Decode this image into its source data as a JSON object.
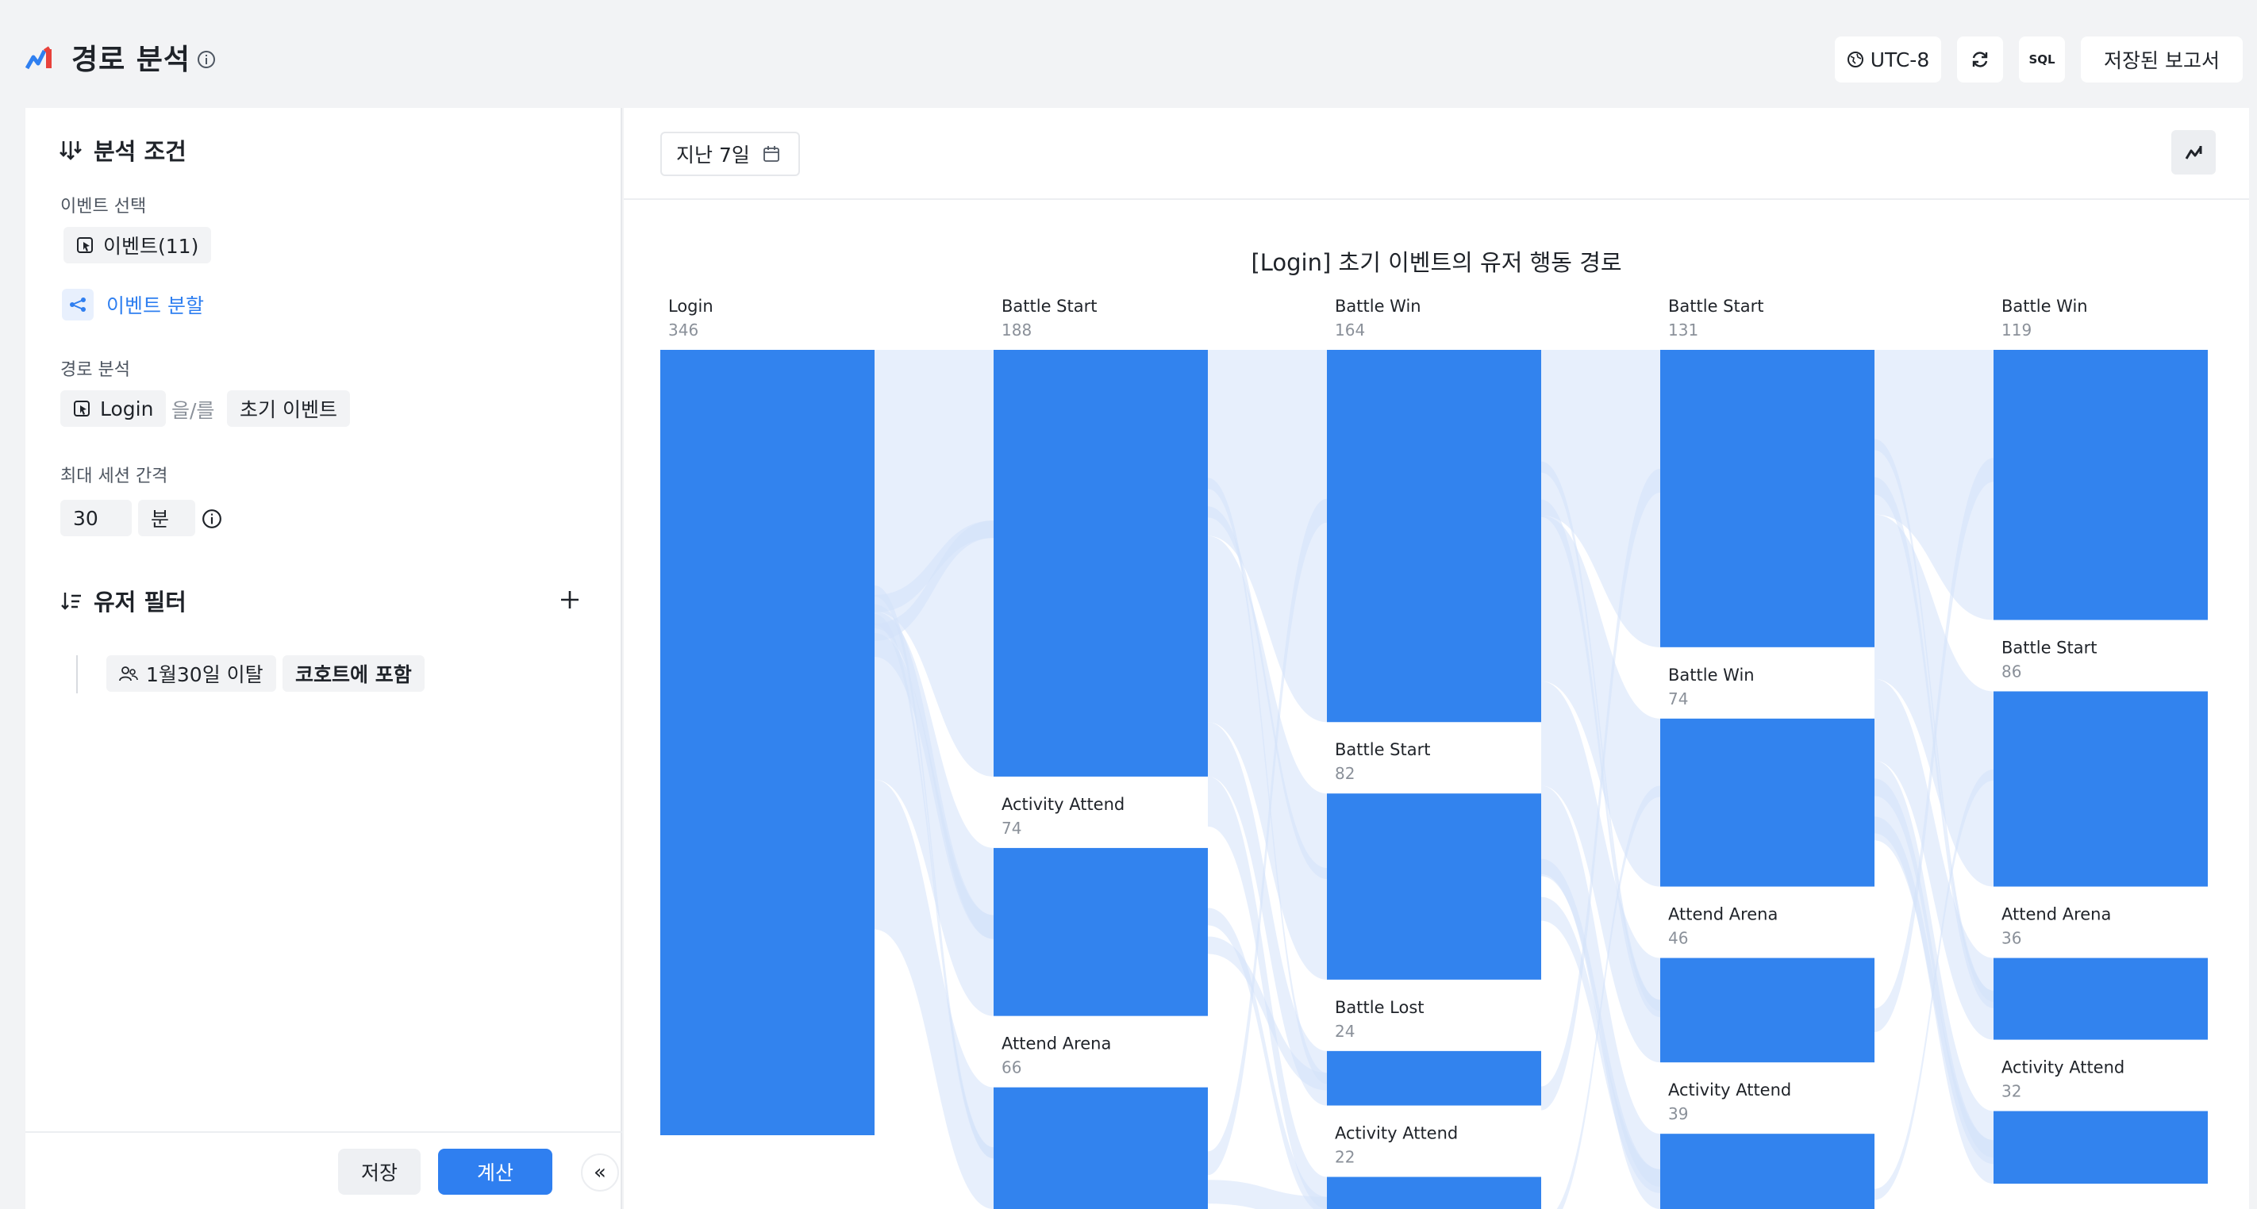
{
  "header": {
    "title": "경로 분석",
    "timezone": "UTC-8",
    "sql_label": "SQL",
    "saved_reports": "저장된 보고서"
  },
  "left_panel": {
    "conditions_title": "분석 조건",
    "event_select_label": "이벤트 선택",
    "events_chip": "이벤트(11)",
    "event_split_link": "이벤트 분할",
    "path_analysis_label": "경로 분석",
    "path_event": "Login",
    "path_connector": "을/를",
    "path_mode": "초기 이벤트",
    "max_session_label": "최대 세션 간격",
    "max_session_value": "30",
    "max_session_unit": "분",
    "user_filter_title": "유저 필터",
    "filter_cohort": "1월30일 이탈",
    "filter_condition": "코호트에 포함",
    "save_button": "저장",
    "calculate_button": "계산"
  },
  "toolbar": {
    "date_range": "지난 7일"
  },
  "colors": {
    "accent": "#2f7ff0",
    "node": "#3283ee",
    "flow": "#dfe9fb"
  },
  "chart_data": {
    "type": "sankey",
    "title": "[Login] 초기 이벤트의 유저 행동 경로",
    "columns": [
      {
        "nodes": [
          {
            "name": "Login",
            "value": 346
          }
        ]
      },
      {
        "nodes": [
          {
            "name": "Battle Start",
            "value": 188
          },
          {
            "name": "Activity Attend",
            "value": 74
          },
          {
            "name": "Attend Arena",
            "value": 66
          }
        ]
      },
      {
        "nodes": [
          {
            "name": "Battle Win",
            "value": 164
          },
          {
            "name": "Battle Start",
            "value": 82
          },
          {
            "name": "Battle Lost",
            "value": 24
          },
          {
            "name": "Activity Attend",
            "value": 22
          }
        ]
      },
      {
        "nodes": [
          {
            "name": "Battle Start",
            "value": 131
          },
          {
            "name": "Battle Win",
            "value": 74
          },
          {
            "name": "Attend Arena",
            "value": 46
          },
          {
            "name": "Activity Attend",
            "value": 39
          }
        ]
      },
      {
        "nodes": [
          {
            "name": "Battle Win",
            "value": 119
          },
          {
            "name": "Battle Start",
            "value": 86
          },
          {
            "name": "Attend Arena",
            "value": 36
          },
          {
            "name": "Activity Attend",
            "value": 32
          }
        ]
      }
    ]
  }
}
